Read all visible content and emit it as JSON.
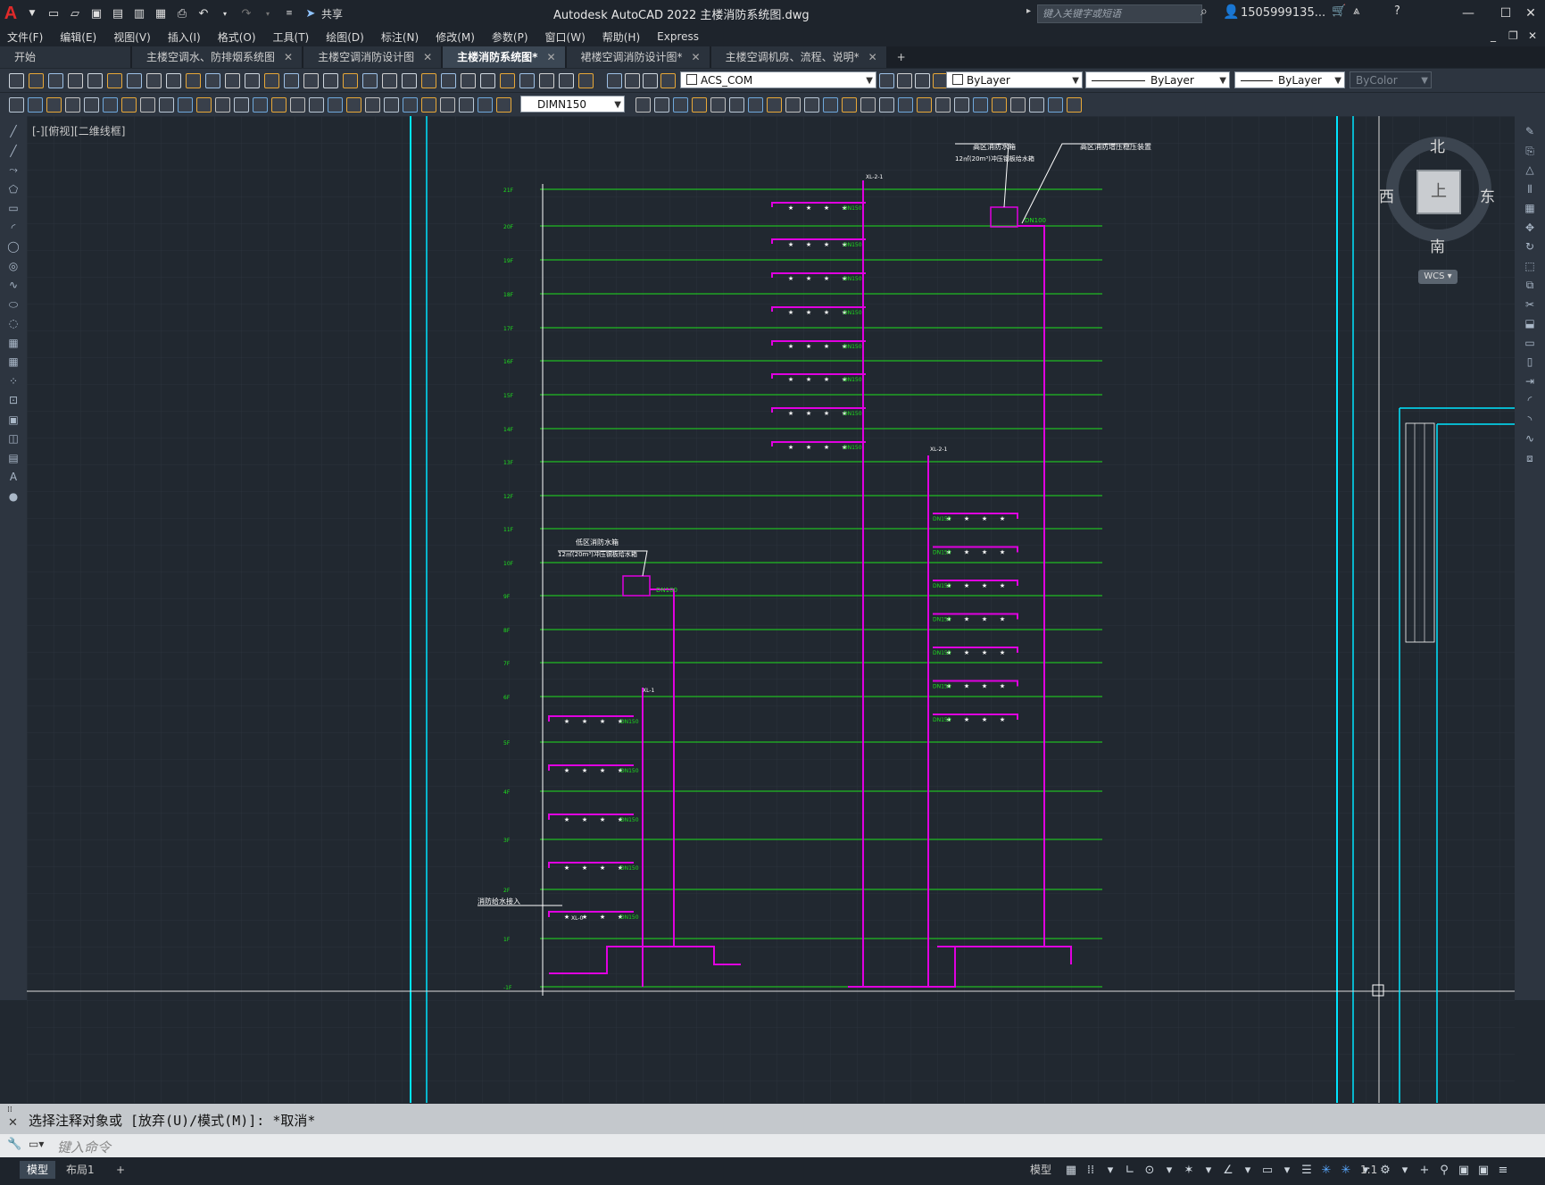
{
  "app": {
    "title": "Autodesk AutoCAD 2022    主楼消防系统图.dwg",
    "share_label": "共享",
    "search_placeholder": "键入关键字或短语",
    "user": "1505999135...",
    "logo": "A"
  },
  "menu": [
    "文件(F)",
    "编辑(E)",
    "视图(V)",
    "插入(I)",
    "格式(O)",
    "工具(T)",
    "绘图(D)",
    "标注(N)",
    "修改(M)",
    "参数(P)",
    "窗口(W)",
    "帮助(H)",
    "Express"
  ],
  "tabs": [
    {
      "label": "开始",
      "closable": false,
      "active": false
    },
    {
      "label": "主楼空调水、防排烟系统图",
      "closable": true,
      "active": false
    },
    {
      "label": "主楼空调消防设计图",
      "closable": true,
      "active": false
    },
    {
      "label": "主楼消防系统图*",
      "closable": true,
      "active": true
    },
    {
      "label": "裙楼空调消防设计图*",
      "closable": true,
      "active": false
    },
    {
      "label": "主楼空调机房、流程、说明*",
      "closable": true,
      "active": false
    }
  ],
  "properties": {
    "layer": "ACS_COM",
    "color": "ByLayer",
    "linetype": "ByLayer",
    "lineweight": "ByLayer",
    "plotstyle": "ByColor",
    "dimstyle": "DIMN150"
  },
  "viewport_label": "[-][俯视][二维线框]",
  "compass": {
    "north": "北",
    "south": "南",
    "east": "东",
    "west": "西",
    "top": "上",
    "ucs": "WCS"
  },
  "drawing": {
    "floors": [
      "21F",
      "20F",
      "19F",
      "18F",
      "17F",
      "16F",
      "15F",
      "14F",
      "13F",
      "12F",
      "11F",
      "10F",
      "9F",
      "8F",
      "7F",
      "6F",
      "5F",
      "4F",
      "3F",
      "2F",
      "1F",
      "-1F"
    ],
    "high_tank_label": "高区消防水箱",
    "high_tank_sub": "12㎡(20m³)冲压钢板给水箱",
    "high_pressure_label": "高区消防增压稳压装置",
    "low_tank_label": "低区消防水箱",
    "low_tank_sub": "12㎡(20m³)冲压钢板给水箱",
    "pipe_label": "DN150",
    "pipe_label_100": "DN100",
    "riser_1": "XL-2-1",
    "riser_2": "XL-2-1",
    "riser_3": "XL-1",
    "riser_4": "XL-0",
    "ground_label": "消防给水接入"
  },
  "command": {
    "output": "选择注释对象或 [放弃(U)/模式(M)]: *取消*",
    "placeholder": "键入命令"
  },
  "status": {
    "layout_tabs": [
      {
        "label": "模型",
        "active": true
      },
      {
        "label": "布局1",
        "active": false
      }
    ],
    "model_button": "模型",
    "scale": "1:1"
  },
  "colors": {
    "background": "#212830",
    "grid": "#2a323c",
    "floor_line": "#1ee01e",
    "pipe": "#e000e0",
    "cyan": "#00e5ff",
    "label": "#ffffff"
  }
}
